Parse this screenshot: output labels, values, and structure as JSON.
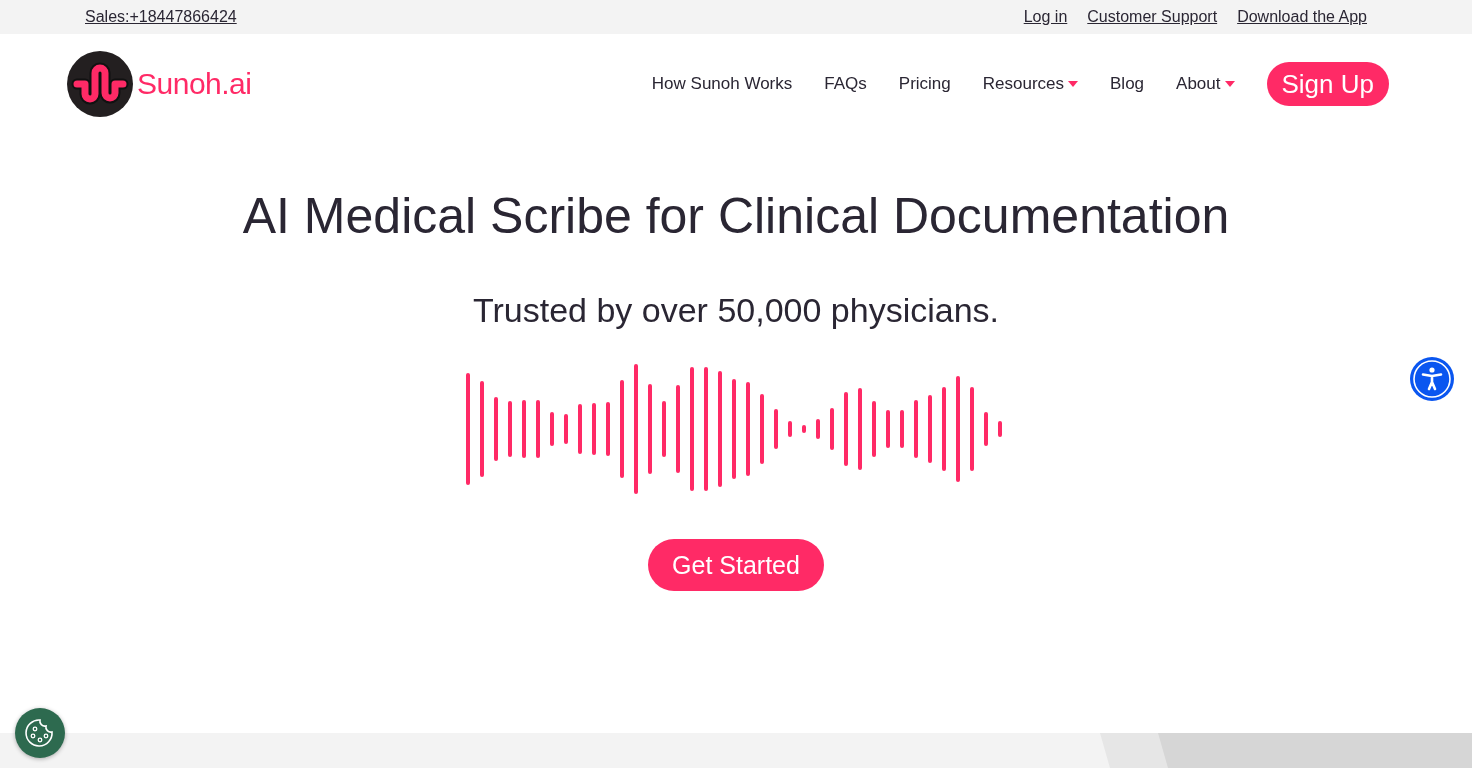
{
  "top_bar": {
    "sales": "Sales:+18447866424",
    "links": [
      "Log in",
      "Customer Support",
      "Download the App"
    ]
  },
  "header": {
    "logo": "Sunoh.ai",
    "nav": [
      {
        "label": "How Sunoh Works",
        "dropdown": false
      },
      {
        "label": "FAQs",
        "dropdown": false
      },
      {
        "label": "Pricing",
        "dropdown": false
      },
      {
        "label": "Resources",
        "dropdown": true
      },
      {
        "label": "Blog",
        "dropdown": false
      },
      {
        "label": "About",
        "dropdown": true
      }
    ],
    "cta": "Sign Up"
  },
  "hero": {
    "title": "AI Medical Scribe for Clinical Documentation",
    "subtitle": "Trusted by over 50,000 physicians.",
    "button": "Get Started"
  }
}
